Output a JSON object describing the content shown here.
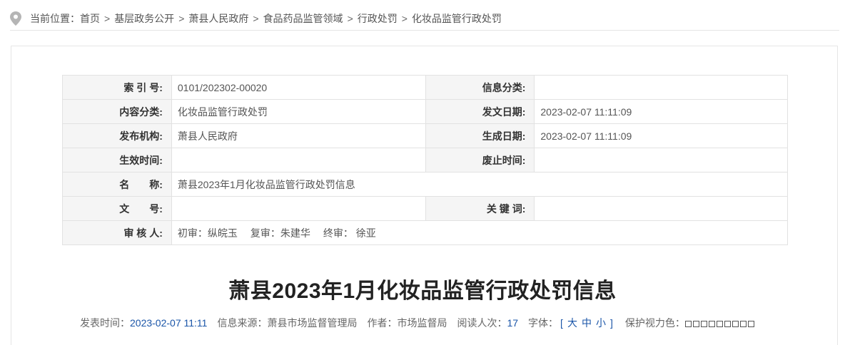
{
  "breadcrumb": {
    "prefix": "当前位置：",
    "items": [
      "首页",
      "基层政务公开",
      "萧县人民政府",
      "食品药品监管领域",
      "行政处罚",
      "化妆品监管行政处罚"
    ],
    "separator": ">"
  },
  "meta": {
    "index_label": "索 引 号:",
    "index_value": "0101/202302-00020",
    "info_category_label": "信息分类:",
    "info_category_value": "",
    "content_category_label": "内容分类:",
    "content_category_value": "化妆品监管行政处罚",
    "issue_date_label": "发文日期:",
    "issue_date_value": "2023-02-07 11:11:09",
    "publisher_label": "发布机构:",
    "publisher_value": "萧县人民政府",
    "generated_date_label": "生成日期:",
    "generated_date_value": "2023-02-07 11:11:09",
    "effective_label": "生效时间:",
    "effective_value": "",
    "abolish_label": "废止时间:",
    "abolish_value": "",
    "name_label": "名　　称:",
    "name_value": "萧县2023年1月化妆品监管行政处罚信息",
    "doc_no_label": "文　　号:",
    "doc_no_value": "",
    "keywords_label": "关 键 词:",
    "keywords_value": "",
    "reviewer_label": "审 核 人:",
    "reviewer": {
      "first_label": "初审：",
      "first_name": "纵皖玉",
      "second_label": "复审：",
      "second_name": "朱建华",
      "final_label": "终审：",
      "final_name": "徐亚"
    }
  },
  "article": {
    "title": "萧县2023年1月化妆品监管行政处罚信息",
    "publish_label": "发表时间：",
    "publish_time": "2023-02-07 11:11",
    "source_label": "信息来源：",
    "source": "萧县市场监督管理局",
    "author_label": "作者：",
    "author": "市场监督局",
    "reads_label": "阅读人次：",
    "reads": "17",
    "font_label": "字体：",
    "font_open": "[",
    "font_large": "大",
    "font_medium": "中",
    "font_small": "小",
    "font_close": "]",
    "eye_label": "保护视力色：",
    "swatch_count": 9
  },
  "colors": {
    "link_blue": "#1a55a8",
    "label_bg": "#f5f5f5",
    "border": "#e2e2e2"
  }
}
